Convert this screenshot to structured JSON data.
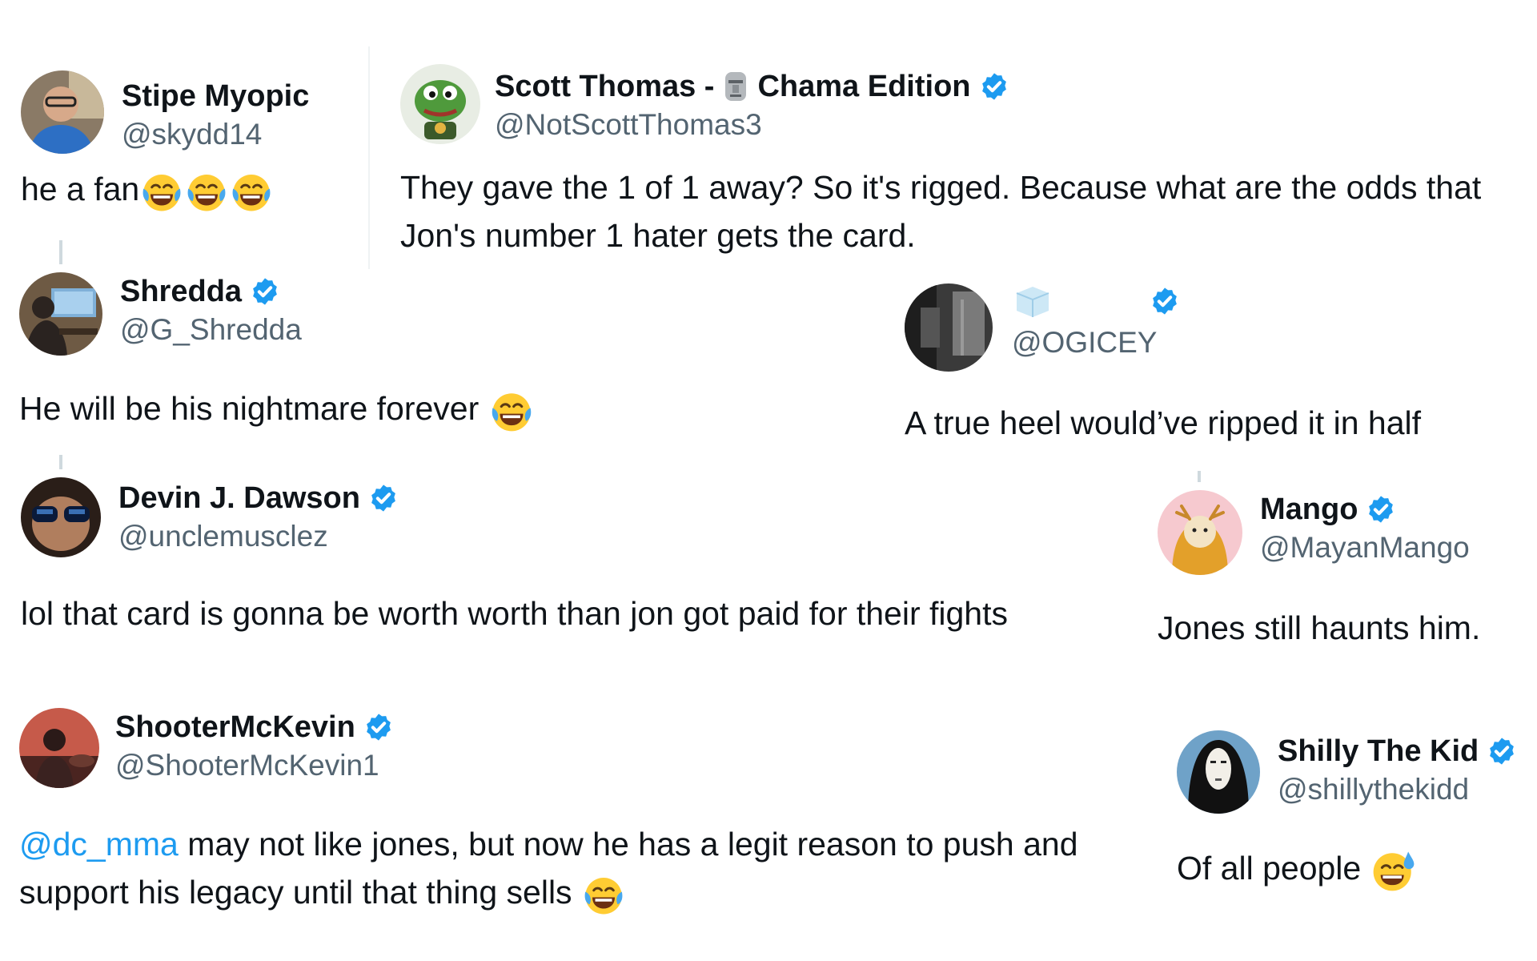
{
  "tweets": [
    {
      "display_name": "Stipe Myopic",
      "handle": "@skydd14",
      "text": "he a fan"
    },
    {
      "display_name": "Scott Thomas - ",
      "display_name_suffix": "Chama Edition",
      "handle": "@NotScottThomas3",
      "text": "They gave the 1 of 1 away? So it's rigged. Because what are the odds that Jon's number 1 hater gets the card."
    },
    {
      "display_name": "Shredda",
      "handle": "@G_Shredda",
      "text": "He will be his nightmare forever"
    },
    {
      "display_name": "",
      "handle": "@OGICEY",
      "text": "A true heel would’ve ripped it in half"
    },
    {
      "display_name": "Devin J. Dawson",
      "handle": "@unclemusclez",
      "text": "lol that card is gonna be worth worth than jon got paid for their fights"
    },
    {
      "display_name": "Mango",
      "handle": "@MayanMango",
      "text": "Jones still haunts him."
    },
    {
      "display_name": "ShooterMcKevin",
      "handle": "@ShooterMcKevin1",
      "mention": "@dc_mma",
      "text": " may not like jones, but now he has a legit reason to push and support his legacy until that thing sells"
    },
    {
      "display_name": "Shilly The Kid",
      "handle": "@shillythekidd",
      "text": "Of all people"
    }
  ],
  "colors": {
    "verified": "#1d9bf0",
    "handle": "#536471",
    "mention": "#1d9bf0",
    "text": "#0f1419"
  },
  "icons": {
    "verified": "verified-badge-icon",
    "laugh": "face-with-tears-of-joy-icon",
    "sweat": "grinning-face-with-sweat-icon",
    "moai": "moai-icon",
    "ice": "ice-cube-icon"
  }
}
